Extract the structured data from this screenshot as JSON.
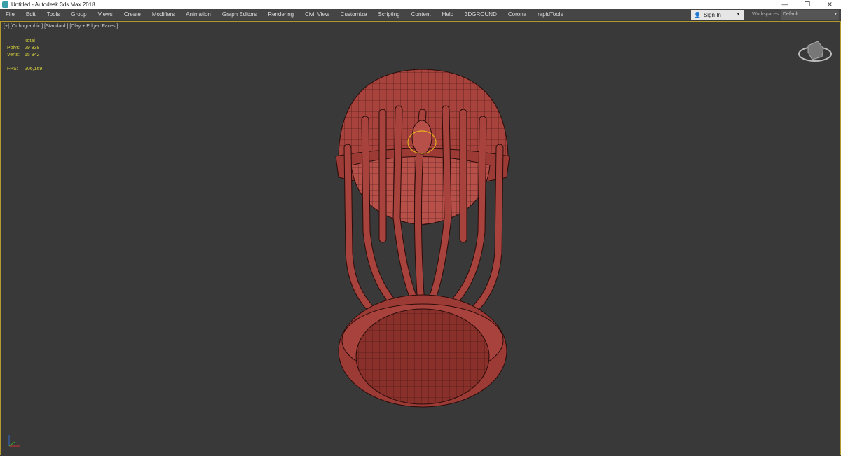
{
  "window": {
    "title": "Untitled - Autodesk 3ds Max 2018",
    "controls": [
      "minimize",
      "restore",
      "close"
    ]
  },
  "menu": [
    "File",
    "Edit",
    "Tools",
    "Group",
    "Views",
    "Create",
    "Modifiers",
    "Animation",
    "Graph Editors",
    "Rendering",
    "Civil View",
    "Customize",
    "Scripting",
    "Content",
    "Help",
    "3DGROUND",
    "Corona",
    "rapidTools"
  ],
  "account": {
    "sign_in": "Sign In"
  },
  "workspaces": {
    "label": "Workspaces:",
    "value": "Default"
  },
  "viewport": {
    "label": "[+] [Orthographic ] [Standard ] [Clay + Edged Faces ]",
    "stats": {
      "header": "Total",
      "polys_label": "Polys:",
      "polys": "29 338",
      "verts_label": "Verts:",
      "verts": "15 342",
      "fps_label": "FPS:",
      "fps": "206,169"
    },
    "model_color": "#a8423c"
  }
}
